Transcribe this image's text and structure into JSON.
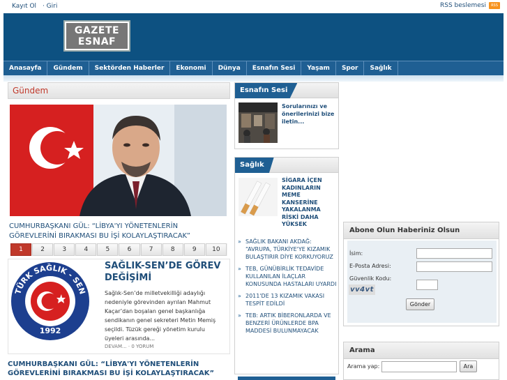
{
  "topbar": {
    "register": "Kayıt Ol",
    "login": "· Giri",
    "rss_label": "RSS beslemesi",
    "rss_badge": "RSS"
  },
  "logo": {
    "line1": "GAZETE",
    "line2": "ESNAF"
  },
  "nav": [
    "Anasayfa",
    "Gündem",
    "Sektörden Haberler",
    "Ekonomi",
    "Dünya",
    "Esnafın Sesi",
    "Yaşam",
    "Spor",
    "Sağlık"
  ],
  "gundem": {
    "heading": "Gündem",
    "hero_caption": "CUMHURBAŞKANI GÜL: “LİBYA'YI YÖNETENLERİN GÖREVLERİNİ BIRAKMASI BU İŞİ KOLAYLAŞTIRACAK”",
    "pages": [
      "1",
      "2",
      "3",
      "4",
      "5",
      "6",
      "7",
      "8",
      "9",
      "10"
    ],
    "active_page": "1",
    "story": {
      "title": "SAĞLIK-SEN’DE GÖREV DEĞİŞİMİ",
      "text": "Sağlık-Sen’de milletvekilliği adaylığı nedeniyle görevinden ayrılan Mahmut Kaçar’dan boşalan genel başkanlığa sendikanın genel sekreteri Metin Memiş seçildi. Tüzük gereği yönetim kurulu üyeleri arasında...",
      "more": "DEVAM... · 0 YORUM",
      "logo_top": "TÜRK SAĞLIK - SEN",
      "logo_year": "1992"
    },
    "bottom_title": "CUMHURBAŞKANI GÜL: “LİBYA'YI YÖNETENLERİN GÖREVLERİNİ BIRAKMASI BU İŞİ KOLAYLAŞTIRACAK”"
  },
  "esnaf_sesi": {
    "heading": "Esnafın Sesi",
    "text": "Sorularınızı ve önerilerinizi bize iletin..."
  },
  "saglik": {
    "heading": "Sağlık",
    "featured": "SİGARA İÇEN KADINLARIN MEME KANSERİNE YAKALANMA RİSKİ DAHA YÜKSEK",
    "items": [
      "SAĞLIK BAKANI AKDAĞ: “AVRUPA, TÜRKİYE'YE KIZAMIK BULAŞTIRIR DİYE KORKUYORUZ",
      "TEB, GÜNÜBİRLİK TEDAVİDE KULLANILAN İLAÇLAR KONUSUNDA HASTALARI UYARDI",
      "2011'DE 13 KIZAMIK VAKASI TESPİT EDİLDİ",
      "TEB: ARTIK BİBERONLARDA VE BENZERİ ÜRÜNLERDE BPA MADDESİ BULUNMAYACAK"
    ]
  },
  "subscribe": {
    "heading": "Abone Olun Haberiniz Olsun",
    "name_label": "İsim:",
    "email_label": "E-Posta Adresi:",
    "security_label": "Güvenlik Kodu:",
    "captcha": "vv4vt",
    "submit": "Gönder"
  },
  "search": {
    "heading": "Arama",
    "label": "Arama yap:",
    "button": "Ara"
  },
  "colors": {
    "brand_blue": "#0d5181",
    "nav_blue": "#1f5f93",
    "accent_red": "#c0392b"
  }
}
